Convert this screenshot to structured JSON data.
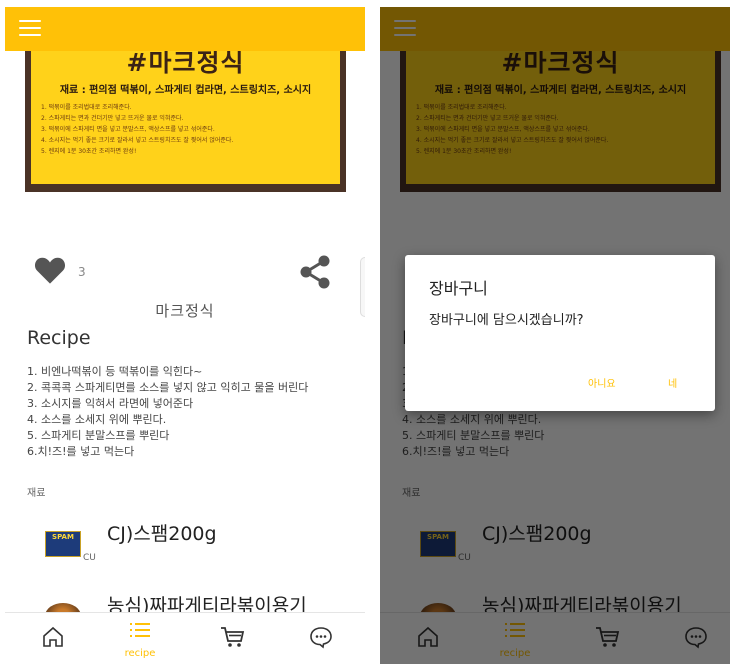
{
  "hero": {
    "title": "#마크정식",
    "ingredients_line": "재료 : 편의점 떡볶이, 스파게티 컵라면, 스트링치즈, 소시지",
    "steps": [
      "1. 떡볶이를 조리법대로 조리해준다.",
      "2. 스파게티는 면과 건더기만 넣고 뜨거운 물로 익혀준다.",
      "3. 떡볶이에 스파게티 면을 넣고 분말스프, 액상스프를 넣고 섞어준다.",
      "4. 소시지는 먹기 좋은 크기로 잘라서 넣고 스트링치즈도 잘 찢어서 얹어준다.",
      "5. 렌지에 1분 30초간 조리하면 완성!"
    ]
  },
  "likes": {
    "count": "3"
  },
  "recipe": {
    "name": "마크정식",
    "section_title": "Recipe",
    "steps": [
      "1. 비엔나떡볶이 등 떡볶이를 익힌다~",
      "2. 콕콕콕 스파게티면를 소스를 넣지 않고 익히고 물을 버린다",
      "3. 소시지를 익혀서 라면에 넣어준다",
      "4. 소스를 소세지 위에 뿌린다.",
      "5. 스파게티 분말스프를 뿌린다",
      "6.치!즈!를 넣고 먹는다"
    ]
  },
  "ingredients": {
    "label": "재료",
    "items": [
      {
        "name": "CJ)스팸200g",
        "store": "CU",
        "image_text": "SPAM"
      },
      {
        "name": "농심)짜파게티라볶이용기",
        "store": "",
        "image_text": ""
      }
    ]
  },
  "nav": {
    "items": [
      {
        "icon": "home-icon",
        "label": ""
      },
      {
        "icon": "list-icon",
        "label": "recipe"
      },
      {
        "icon": "cart-icon",
        "label": ""
      },
      {
        "icon": "chat-icon",
        "label": ""
      }
    ]
  },
  "dialog": {
    "title": "장바구니",
    "message": "장바구니에 담으시겠습니까?",
    "cancel": "아니요",
    "confirm": "네"
  },
  "colors": {
    "accent": "#ffc107",
    "heart": "#555555"
  }
}
